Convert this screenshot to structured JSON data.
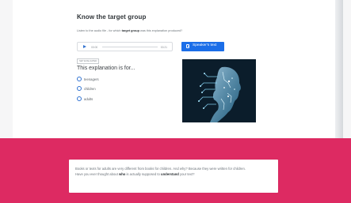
{
  "page": {
    "title": "Know the target group",
    "instruction": "Listen to the audio file - for which target group was this explanation produced?",
    "instruction_parts": {
      "before": "Listen to the audio file - for which ",
      "bold": "target group",
      "after": " was this explanation produced?"
    }
  },
  "audio": {
    "time_current": "00:00",
    "time_total": "00:21"
  },
  "speaker_button": {
    "label": "Speaker's text"
  },
  "question": {
    "tag": "SET EVALUATED",
    "text": "This explanation is for...",
    "options": [
      {
        "label": "teenagers"
      },
      {
        "label": "children"
      },
      {
        "label": "adults"
      }
    ]
  },
  "colors": {
    "pink": "#dd2a62",
    "button_blue": "#1b6ee8",
    "title_text": "#2f3438"
  },
  "popup": {
    "line1": "Books or texts for adults are very different from books for children. And why? Because they were written for children.",
    "line2_parts": {
      "a": "Have you ever thought about ",
      "who": "who",
      "b": " is actually supposed to ",
      "understand": "understand",
      "c": " your text?"
    }
  }
}
